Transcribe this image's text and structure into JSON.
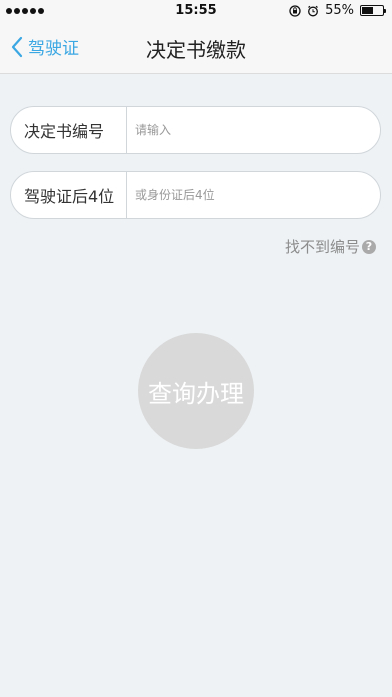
{
  "status_bar": {
    "time": "15:55",
    "battery_text": "55%",
    "battery_level": 0.55,
    "icons": [
      "signal-dots-icon",
      "rotation-lock-icon",
      "alarm-icon",
      "battery-icon"
    ]
  },
  "nav": {
    "back_label": "驾驶证",
    "title": "决定书缴款",
    "accent_color": "#3ba7e3"
  },
  "form": {
    "decision_number": {
      "label": "决定书编号",
      "placeholder": "请输入",
      "value": ""
    },
    "license_last4": {
      "label": "驾驶证后4位",
      "placeholder": "或身份证后4位",
      "value": ""
    }
  },
  "help": {
    "label": "找不到编号",
    "icon_glyph": "?"
  },
  "query_button": {
    "label": "查询办理",
    "color": "#d9d9d9"
  }
}
